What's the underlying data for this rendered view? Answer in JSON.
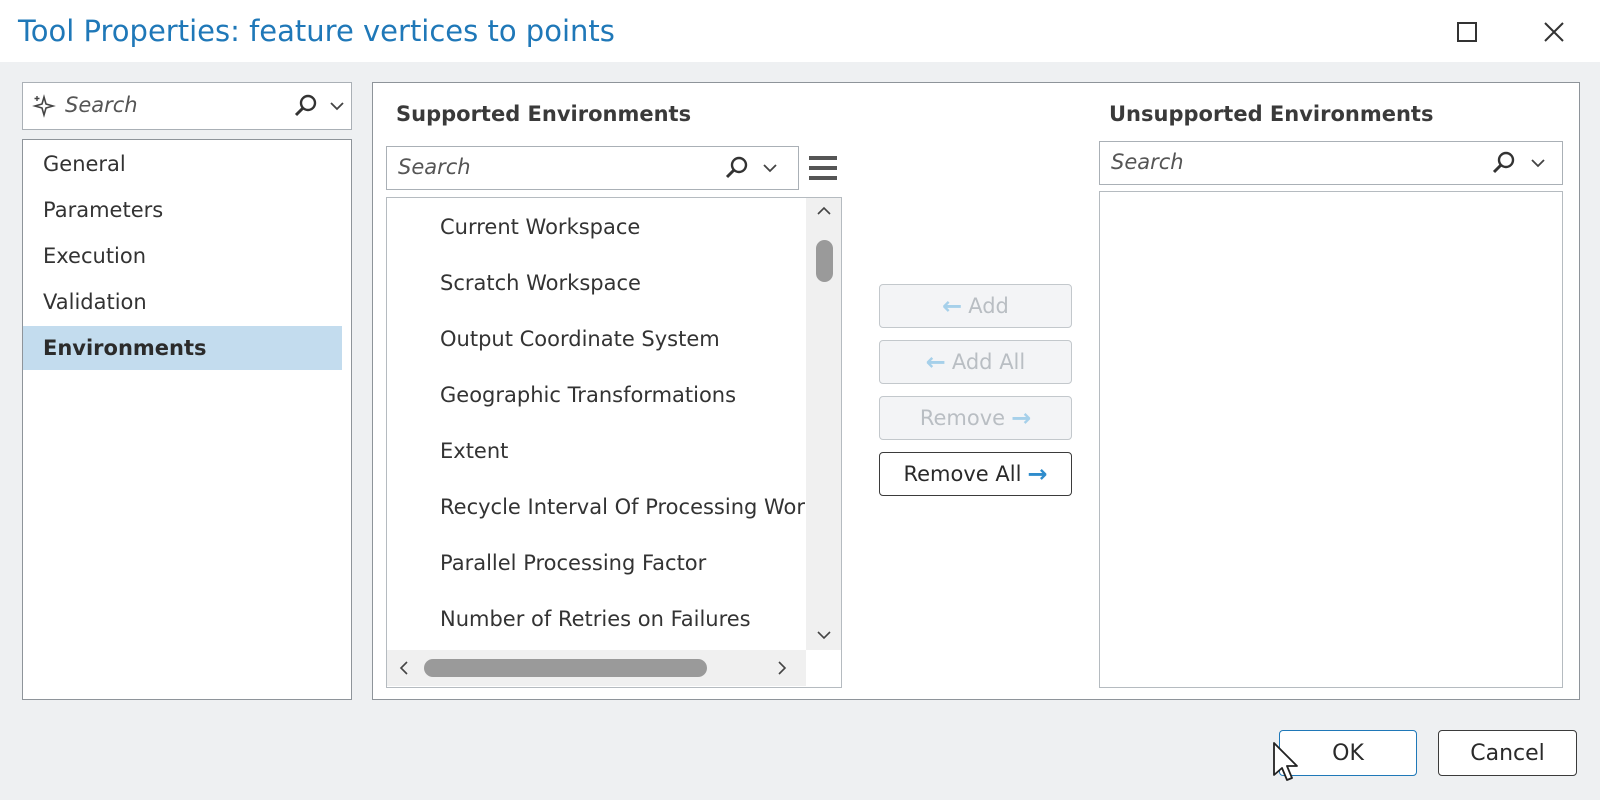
{
  "window": {
    "title": "Tool Properties: feature vertices to points"
  },
  "sidebar": {
    "search_placeholder": "Search",
    "items": [
      {
        "label": "General"
      },
      {
        "label": "Parameters"
      },
      {
        "label": "Execution"
      },
      {
        "label": "Validation"
      },
      {
        "label": "Environments",
        "selected": true
      }
    ]
  },
  "supported": {
    "heading": "Supported Environments",
    "search_placeholder": "Search",
    "items": [
      "Current Workspace",
      "Scratch Workspace",
      "Output Coordinate System",
      "Geographic Transformations",
      "Extent",
      "Recycle Interval Of Processing Workers",
      "Parallel Processing Factor",
      "Number of Retries on Failures"
    ]
  },
  "transfer": {
    "add": "Add",
    "add_all": "Add All",
    "remove": "Remove",
    "remove_all": "Remove All"
  },
  "unsupported": {
    "heading": "Unsupported Environments",
    "search_placeholder": "Search"
  },
  "footer": {
    "ok": "OK",
    "cancel": "Cancel"
  },
  "colors": {
    "title": "#1f78b8",
    "selected_nav": "#c3dcee",
    "arrow_enabled": "#2f8ccc",
    "arrow_disabled": "#a6d0ea"
  },
  "icons": [
    "maximize-icon",
    "close-icon",
    "sparkle-icon",
    "search-icon",
    "chevron-down-icon",
    "menu-icon",
    "chevron-up-icon",
    "chevron-left-icon",
    "chevron-right-icon",
    "arrow-left-icon",
    "arrow-right-icon",
    "cursor-pointer"
  ]
}
